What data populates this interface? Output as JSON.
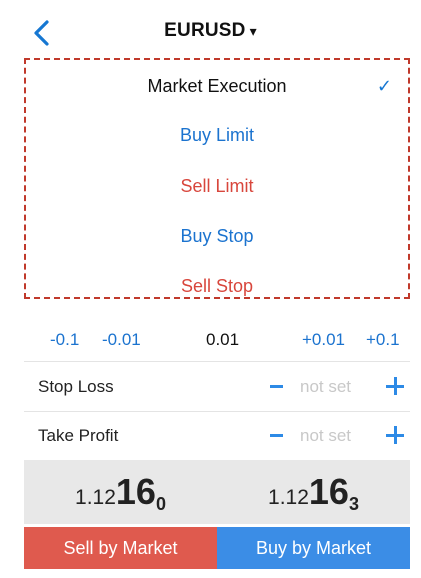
{
  "header": {
    "symbol": "EURUSD",
    "caret": "▾",
    "back_icon": "chevron-left-icon",
    "accent": "#1677d2"
  },
  "order_types": [
    {
      "label": "Market Execution",
      "selected": true,
      "color": "#111111"
    },
    {
      "label": "Buy Limit",
      "selected": false,
      "color": "#1b73cf"
    },
    {
      "label": "Sell Limit",
      "selected": false,
      "color": "#d8463c"
    },
    {
      "label": "Buy Stop",
      "selected": false,
      "color": "#1b73cf"
    },
    {
      "label": "Sell Stop",
      "selected": false,
      "color": "#d8463c"
    }
  ],
  "check_mark": "✓",
  "volume": {
    "dec_large": "-0.1",
    "dec_small": "-0.01",
    "value": "0.01",
    "inc_small": "+0.01",
    "inc_large": "+0.1"
  },
  "stop_loss": {
    "label": "Stop Loss",
    "value": "not set"
  },
  "take_profit": {
    "label": "Take Profit",
    "value": "not set"
  },
  "bid": {
    "prefix": "1.12",
    "big": "16",
    "sup": "0"
  },
  "ask": {
    "prefix": "1.12",
    "big": "16",
    "sup": "3"
  },
  "buttons": {
    "sell": "Sell by Market",
    "buy": "Buy by Market"
  },
  "colors": {
    "sell": "#df5a4e",
    "buy": "#3b8de6",
    "highlight_border": "#c0392b"
  }
}
